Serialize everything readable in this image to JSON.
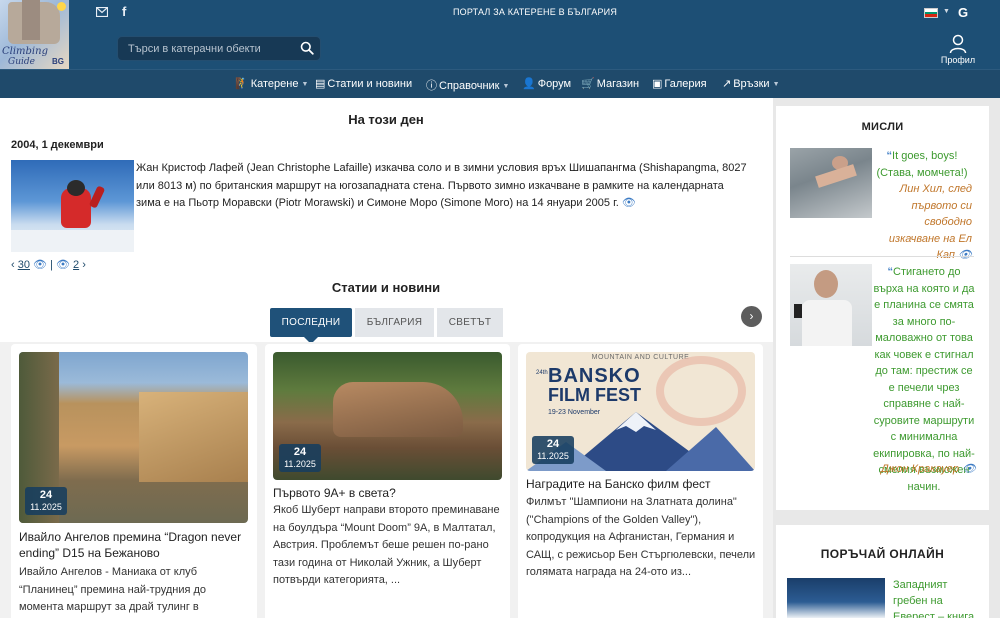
{
  "header": {
    "logo_line1": "Climbing",
    "logo_line2": "Guide",
    "logo_line3": "BG",
    "portal_title": "ПОРТАЛ ЗА КАТЕРЕНЕ В БЪЛГАРИЯ",
    "search_placeholder": "Търси в катерачни обекти",
    "profile_label": "Профил",
    "lang_letter": "G",
    "flag_colors": [
      "#ffffff",
      "#00966e",
      "#d62612"
    ]
  },
  "nav": {
    "items": [
      {
        "label": "Катерене",
        "icon": "climber-icon",
        "dropdown": true
      },
      {
        "label": "Статии и новини",
        "icon": "newspaper-icon",
        "dropdown": false
      },
      {
        "label": "Справочник",
        "icon": "info-icon",
        "dropdown": true
      },
      {
        "label": "Форум",
        "icon": "user-icon",
        "dropdown": false
      },
      {
        "label": "Магазин",
        "icon": "cart-icon",
        "dropdown": false
      },
      {
        "label": "Галерия",
        "icon": "gallery-icon",
        "dropdown": false
      },
      {
        "label": "Връзки",
        "icon": "external-link-icon",
        "dropdown": true
      }
    ]
  },
  "onthisday": {
    "title": "На този ден",
    "date": "2004, 1 декември",
    "text": "Жан Кристоф Лафей (Jean Christophe Lafaille) изкачва соло и в зимни условия връх Шишапангма (Shishapangma, 8027 или 8013 м) по британския маршрут на югозападната стена. Първото зимно изкачване в рамките на календарната зима е на Пьотр Моравски (Piotr Morawski) и Симоне Моро (Simone Moro) на 14 януари 2005 г.",
    "prev_count": "30",
    "next_count": "2",
    "separator": "|"
  },
  "news": {
    "title": "Статии и новини",
    "tabs": [
      "ПОСЛЕДНИ",
      "БЪЛГАРИЯ",
      "СВЕТЪТ"
    ],
    "next_arrow": "›",
    "cards": [
      {
        "day": "24",
        "month": "11.2025",
        "title": "Ивайло Ангелов премина “Dragon never ending” D15 на Бежаново",
        "text": "Ивайло Ангелов - Маниака от клуб “Планинец” премина най-трудния до момента маршрут за драй тулинг в"
      },
      {
        "day": "24",
        "month": "11.2025",
        "title": "Първото 9А+ в света?",
        "text": "Якоб Шуберт направи второто преминаване на боулдъра “Mount Doom” 9А, в Малтатал, Австрия. Проблемът беше решен по-рано тази година от Николай Ужник, а Шуберт потвърди категорията, ..."
      },
      {
        "day": "24",
        "month": "11.2025",
        "title": "Наградите на Банско филм фест",
        "text": "Филмът \"Шампиони на Златната долина\" (\"Champions of the Golden Valley\"), копродукция на Афганистан, Германия и САЩ, с режисьор Бен Стъргюлевски, печели голямата награда на 24-ото из...",
        "poster_top": "MOUNTAIN AND CULTURE",
        "poster_edition": "24th",
        "poster_title1": "BANSKO",
        "poster_title2": "FILM FEST",
        "poster_dates": "19-23 November"
      }
    ]
  },
  "sidebar": {
    "thoughts_title": "МИСЛИ",
    "quotes": [
      {
        "text": "It goes, boys! (Става, момчета!)",
        "author": "Лин Хил, след първото си свободно изкачване на Ел Кап"
      },
      {
        "text": "Стигането до върха на която и да е планина се смята за много по-маловажно от това как човек е стигнал до там: престиж се е печели чрез справяне с най-суровите маршрути с минимална екипировка, по най-смелия възможен начин.",
        "author": "Джон Кракауер"
      }
    ],
    "order_title": "ПОРЪЧАЙ ОНЛАЙН",
    "book_text": "Западният гребен на Еверест – книга"
  }
}
